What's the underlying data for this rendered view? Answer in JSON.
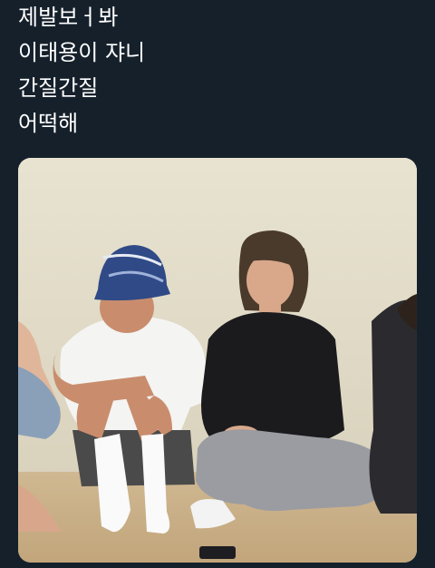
{
  "tweet": {
    "lines": [
      "제발보ㅓ봐",
      "이태용이 쟈니",
      "간질간질",
      "어떡해"
    ]
  },
  "media": {
    "icon": "photo-icon"
  },
  "colors": {
    "background": "#15202b",
    "text": "#ffffff",
    "wall": "#e4dfcd",
    "floor": "#cbb28b"
  }
}
